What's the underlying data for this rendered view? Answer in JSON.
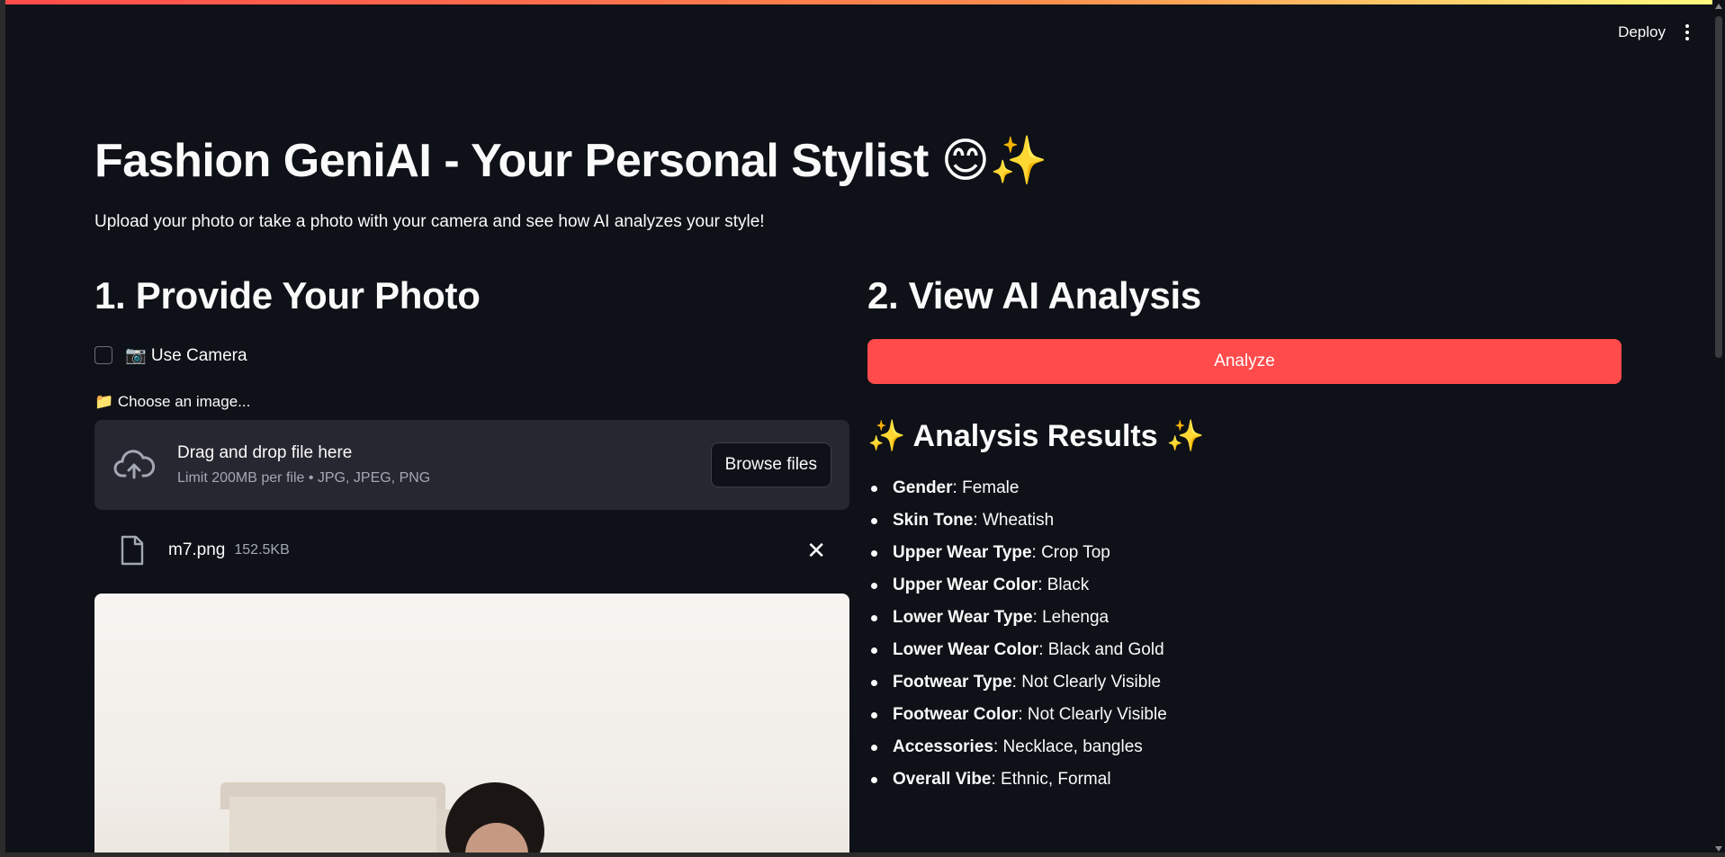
{
  "header": {
    "deploy_label": "Deploy"
  },
  "page": {
    "title": "Fashion GeniAI - Your Personal Stylist 😊✨",
    "subtitle": "Upload your photo or take a photo with your camera and see how AI analyzes your style!"
  },
  "left": {
    "heading": "1. Provide Your Photo",
    "camera_checkbox_label": "📷 Use Camera",
    "camera_checked": false,
    "uploader_label": "📁 Choose an image...",
    "dropzone_main": "Drag and drop file here",
    "dropzone_sub": "Limit 200MB per file • JPG, JPEG, PNG",
    "browse_label": "Browse files",
    "file": {
      "name": "m7.png",
      "size": "152.5KB"
    }
  },
  "right": {
    "heading": "2. View AI Analysis",
    "analyze_label": "Analyze",
    "results_title": "✨ Analysis Results ✨",
    "results": [
      {
        "key": "Gender",
        "value": ": Female"
      },
      {
        "key": "Skin Tone",
        "value": ": Wheatish"
      },
      {
        "key": "Upper Wear Type",
        "value": ": Crop Top"
      },
      {
        "key": "Upper Wear Color",
        "value": ": Black"
      },
      {
        "key": "Lower Wear Type",
        "value": ": Lehenga"
      },
      {
        "key": "Lower Wear Color",
        "value": ": Black and Gold"
      },
      {
        "key": "Footwear Type",
        "value": ": Not Clearly Visible"
      },
      {
        "key": "Footwear Color",
        "value": ": Not Clearly Visible"
      },
      {
        "key": "Accessories",
        "value": ": Necklace, bangles"
      },
      {
        "key": "Overall Vibe",
        "value": ": Ethnic, Formal"
      }
    ]
  },
  "colors": {
    "background": "#0e1117",
    "primary": "#ff4b4b",
    "surface": "#262730"
  }
}
